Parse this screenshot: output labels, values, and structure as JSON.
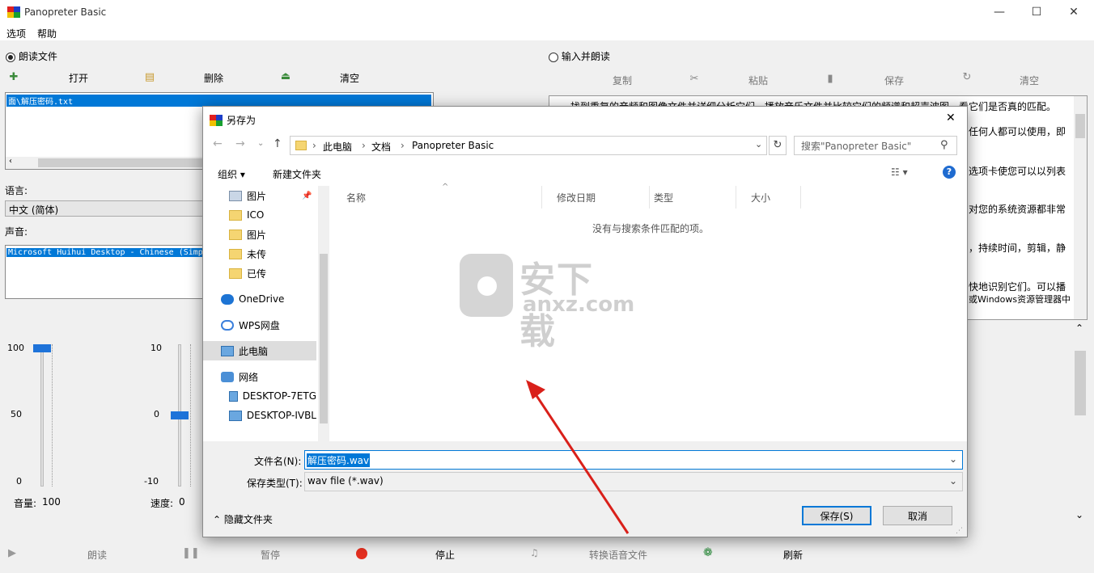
{
  "app": {
    "title": "Panopreter Basic",
    "menu": [
      "选项",
      "帮助"
    ]
  },
  "left": {
    "mode_read_file": "朗读文件",
    "toolbar": {
      "open": "打开",
      "delete": "删除",
      "clear": "清空"
    },
    "file_item": "面\\解压密码.txt",
    "language_label": "语言:",
    "language_value": "中文 (简体)",
    "voice_label": "声音:",
    "voice_item": "Microsoft Huihui Desktop - Chinese (Simplified)",
    "volume": {
      "ticks": [
        "100",
        "50",
        "0"
      ],
      "label": "音量:",
      "value": "100",
      "level": 100
    },
    "speed": {
      "ticks": [
        "10",
        "0",
        "-10"
      ],
      "label": "速度:",
      "value": "0",
      "level": 0
    }
  },
  "right": {
    "mode_input": "输入并朗读",
    "toolbar": {
      "copy": "复制",
      "paste": "粘贴",
      "save": "保存",
      "clear": "清空"
    },
    "lines": [
      "找到重复的音频和图像文件并详细分析它们。播放音乐文件并比较它们的频谱和超声波图，看它们是否真的匹配。",
      "任何人都可以使用，即",
      "选项卡使您可以以列表",
      "对您的系统资源都非常",
      "，持续时间，剪辑，静",
      "快地识别它们。可以播",
      "或Windows资源管理器中"
    ]
  },
  "bottom": {
    "read": "朗读",
    "pause": "暂停",
    "stop": "停止",
    "convert": "转换语音文件",
    "refresh": "刷新"
  },
  "dialog": {
    "title": "另存为",
    "path": [
      "此电脑",
      "文档",
      "Panopreter Basic"
    ],
    "search_placeholder": "搜索\"Panopreter Basic\"",
    "organize": "组织",
    "new_folder": "新建文件夹",
    "nav": [
      "图片",
      "ICO",
      "图片",
      "未传",
      "已传",
      "OneDrive",
      "WPS网盘",
      "此电脑",
      "网络",
      "DESKTOP-7ETG",
      "DESKTOP-IVBL"
    ],
    "columns": [
      "名称",
      "修改日期",
      "类型",
      "大小"
    ],
    "empty_message": "没有与搜索条件匹配的项。",
    "filename_label": "文件名(N):",
    "filename_value": "解压密码.wav",
    "filetype_label": "保存类型(T):",
    "filetype_value": "wav file (*.wav)",
    "hide_folders": "隐藏文件夹",
    "save_button": "保存(S)",
    "cancel_button": "取消"
  },
  "watermark": {
    "cn": "安下载",
    "en": "anxz.com"
  },
  "colors": {
    "accent": "#0078d7",
    "arrow": "#d9201a",
    "thumb": "#1e73d9"
  }
}
